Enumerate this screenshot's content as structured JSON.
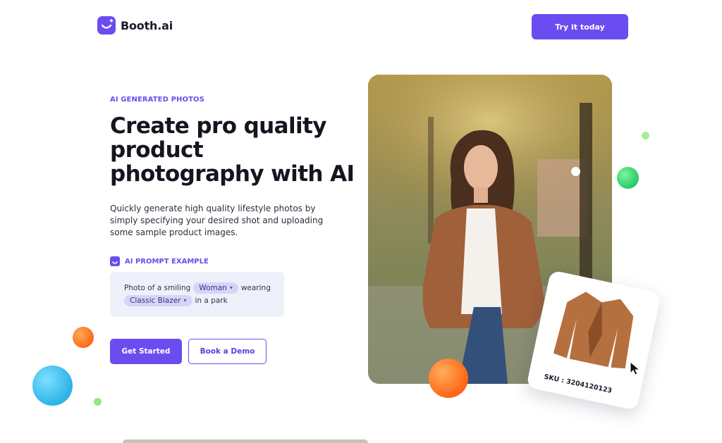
{
  "brand": {
    "name": "Booth.ai",
    "color": "#6a4cf0"
  },
  "header": {
    "cta_label": "Try it today"
  },
  "hero": {
    "eyebrow": "AI GENERATED PHOTOS",
    "headline": "Create pro quality product photography with AI",
    "subtext": "Quickly generate high quality lifestyle photos by simply specifying your desired shot and uploading some sample product images.",
    "prompt_label": "AI PROMPT EXAMPLE",
    "prompt": {
      "part1": "Photo of a smiling",
      "chip1": "Woman",
      "part2": "wearing",
      "chip2": "Classic Blazer",
      "part3": "in a park"
    },
    "primary_button": "Get Started",
    "secondary_button": "Book a Demo"
  },
  "product_card": {
    "sku_text": "SKU : 3204120123"
  },
  "icons": [
    "booth-logo-icon",
    "smile-icon",
    "chevron-down-icon",
    "cursor-arrow-icon"
  ]
}
